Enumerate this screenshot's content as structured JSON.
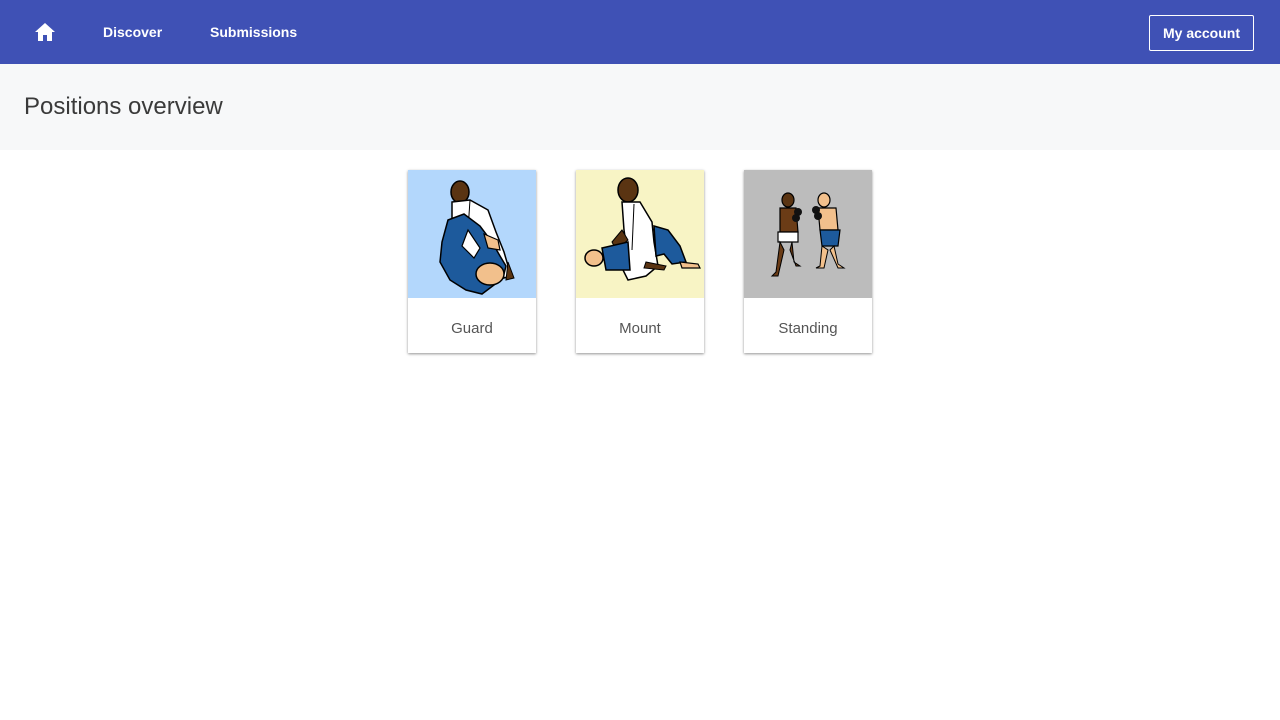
{
  "nav": {
    "home_icon": "home-icon",
    "links": [
      {
        "label": "Discover"
      },
      {
        "label": "Submissions"
      }
    ],
    "account_label": "My account",
    "bar_color": "#3f51b5"
  },
  "page": {
    "title": "Positions overview"
  },
  "positions": [
    {
      "label": "Guard",
      "image": "guard-illustration",
      "bg_color": "#b3d7fc"
    },
    {
      "label": "Mount",
      "image": "mount-illustration",
      "bg_color": "#f8f4c5"
    },
    {
      "label": "Standing",
      "image": "standing-illustration",
      "bg_color": "#bcbcbc"
    }
  ]
}
